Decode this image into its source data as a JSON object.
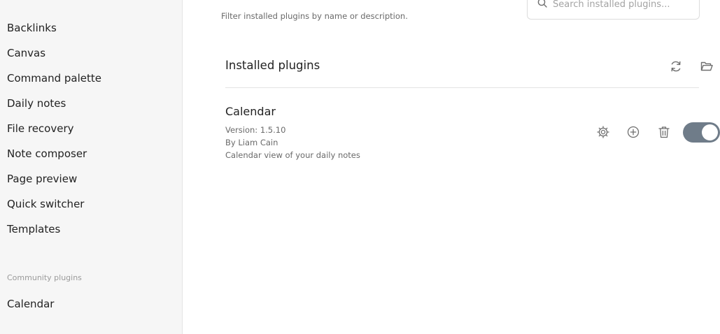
{
  "sidebar": {
    "core_items": [
      {
        "label": "Backlinks"
      },
      {
        "label": "Canvas"
      },
      {
        "label": "Command palette"
      },
      {
        "label": "Daily notes"
      },
      {
        "label": "File recovery"
      },
      {
        "label": "Note composer"
      },
      {
        "label": "Page preview"
      },
      {
        "label": "Quick switcher"
      },
      {
        "label": "Templates"
      }
    ],
    "community_heading": "Community plugins",
    "community_items": [
      {
        "label": "Calendar"
      }
    ]
  },
  "main": {
    "filter_description": "Filter installed plugins by name or description.",
    "search": {
      "placeholder": "Search installed plugins...",
      "value": ""
    },
    "section_title": "Installed plugins",
    "header_icons": [
      "reload-icon",
      "folder-icon"
    ],
    "plugins": [
      {
        "name": "Calendar",
        "version": "Version: 1.5.10",
        "author": "By Liam Cain",
        "description": "Calendar view of your daily notes",
        "enabled": true,
        "action_icons": [
          "gear-icon",
          "plus-circle-icon",
          "trash-icon"
        ]
      }
    ]
  },
  "colors": {
    "sidebar_bg": "#f6f6f6",
    "toggle_on": "#6f7c89",
    "muted_text": "#6a6a6a",
    "heading_muted": "#9a9a9a",
    "icon_color": "#6e6e6e"
  }
}
